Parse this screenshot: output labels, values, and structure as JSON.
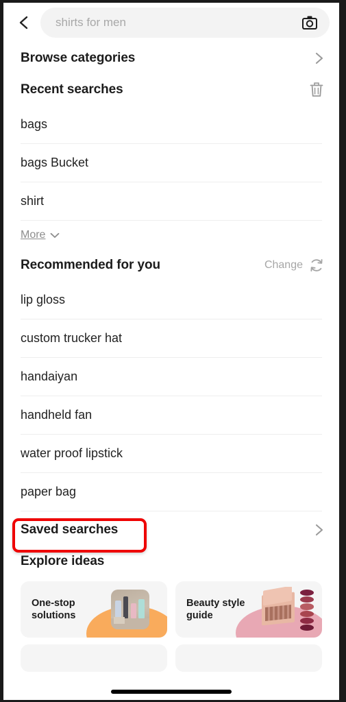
{
  "search": {
    "placeholder": "shirts for men",
    "back_icon": "chevron-left-icon",
    "camera_icon": "camera-icon"
  },
  "browse": {
    "title": "Browse categories",
    "chevron_icon": "chevron-right-icon"
  },
  "recent": {
    "title": "Recent searches",
    "delete_icon": "trash-icon",
    "items": [
      {
        "label": "bags"
      },
      {
        "label": "bags Bucket"
      },
      {
        "label": "shirt"
      }
    ],
    "more_label": "More",
    "more_icon": "chevron-down-icon"
  },
  "recommended": {
    "title": "Recommended for you",
    "change_label": "Change",
    "refresh_icon": "refresh-icon",
    "items": [
      {
        "label": "lip gloss"
      },
      {
        "label": "custom trucker hat"
      },
      {
        "label": "handaiyan"
      },
      {
        "label": "handheld fan"
      },
      {
        "label": "water proof lipstick"
      },
      {
        "label": "paper bag"
      }
    ]
  },
  "saved": {
    "title": "Saved searches",
    "chevron_icon": "chevron-right-icon",
    "highlight_color": "#ee0000"
  },
  "explore": {
    "title": "Explore ideas",
    "cards": [
      {
        "label": "One-stop solutions",
        "accent": "#f9ab5c"
      },
      {
        "label": "Beauty style guide",
        "accent": "#e8a8b4"
      }
    ]
  }
}
